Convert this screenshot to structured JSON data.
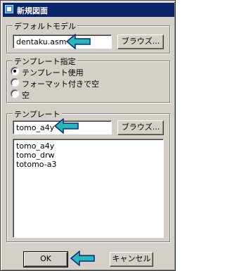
{
  "window": {
    "title": "新規図面",
    "icon": "window-app-icon"
  },
  "default_model": {
    "label": "デフォルトモデル",
    "value": "dentaku.asm",
    "browse_label": "ブラウズ..."
  },
  "template_spec": {
    "label": "テンプレート指定",
    "options": [
      {
        "label": "テンプレート使用",
        "checked": true
      },
      {
        "label": "フォーマット付きで空",
        "checked": false
      },
      {
        "label": "空",
        "checked": false
      }
    ]
  },
  "template": {
    "label": "テンプレート",
    "value": "tomo_a4y",
    "browse_label": "ブラウズ...",
    "list": [
      "tomo_a4y",
      "tomo_drw",
      "totomo-a3"
    ]
  },
  "footer": {
    "ok_label": "OK",
    "cancel_label": "キャンセル"
  },
  "colors": {
    "annotation_arrow_fill": "#2ab7b7",
    "annotation_arrow_stroke": "#0b2a7a"
  }
}
